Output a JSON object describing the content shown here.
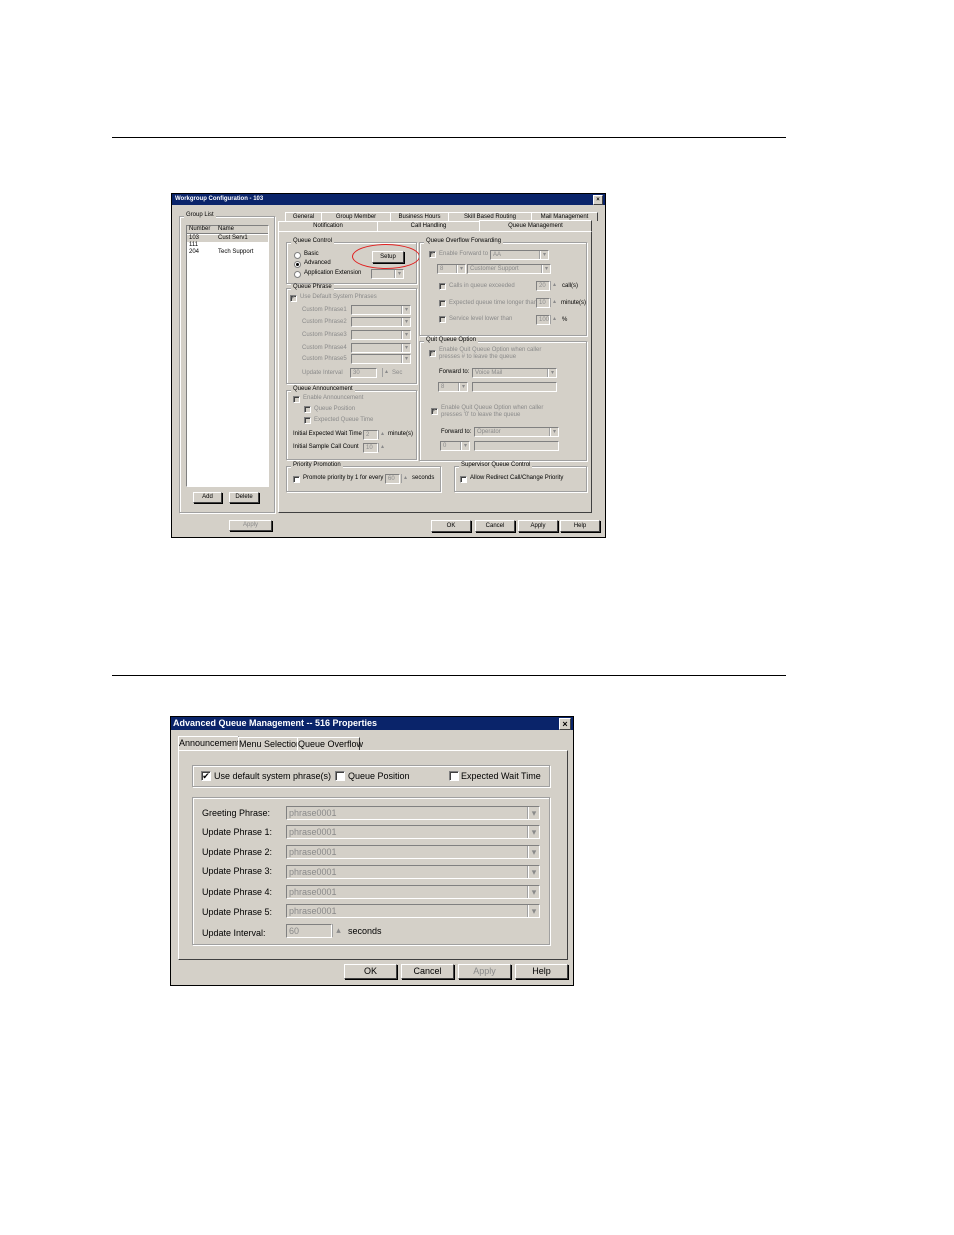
{
  "shot1": {
    "title": "Workgroup Configuration - 103",
    "close": "×",
    "group_list": {
      "label": "Group List",
      "col_number": "Number",
      "col_name": "Name",
      "rows": [
        {
          "number": "103",
          "name": "Cust Serv1"
        },
        {
          "number": "111",
          "name": ""
        },
        {
          "number": "204",
          "name": "Tech Support"
        }
      ],
      "add": "Add",
      "delete": "Delete",
      "apply": "Apply"
    },
    "tabs_row1": [
      "General",
      "Group Member",
      "Business Hours",
      "Skill Based Routing",
      "Mail Management"
    ],
    "tabs_row2": [
      "Notification",
      "Call Handling",
      "Queue Management"
    ],
    "queue_control": {
      "label": "Queue Control",
      "basic": "Basic",
      "advanced": "Advanced",
      "app_ext": "Application Extension",
      "setup": "Setup"
    },
    "queue_phrase": {
      "label": "Queue Phrase",
      "use_default": "Use Default System Phrases",
      "custom": [
        "Custom Phrase1",
        "Custom Phrase2",
        "Custom Phrase3",
        "Custom Phrase4",
        "Custom Phrase5"
      ],
      "update_interval": "Update Interval",
      "interval_value": "30",
      "unit": "Sec"
    },
    "queue_announcement": {
      "label": "Queue Announcement",
      "enable": "Enable Announcement",
      "queue_position": "Queue Position",
      "expected_time": "Expected Queue Time",
      "initial_wait": "Initial Expected Wait Time",
      "initial_wait_value": "2",
      "wait_unit": "minute(s)",
      "sample_count": "Initial Sample Call Count",
      "sample_value": "10"
    },
    "priority": {
      "label": "Priority Promotion",
      "promote": "Promote priority by 1 for every",
      "value": "60",
      "unit": "seconds"
    },
    "overflow": {
      "label": "Queue Overflow Forwarding",
      "enable_fwd": "Enable Forward to",
      "fwd_value": "AA",
      "num_value": "8",
      "target_value": "Customer Support",
      "calls_in_queue": "Calls in queue exceeded",
      "calls_value": "20",
      "calls_unit": "call(s)",
      "expected_wait": "Expected queue time longer than",
      "wait_value": "10",
      "wait_unit": "minute(s)",
      "service_level": "Service level lower than",
      "level_value": "100",
      "level_unit": "%"
    },
    "quit_queue": {
      "label": "Quit Queue Option",
      "enable1a": "Enable Quit Queue Option when caller",
      "enable1b": "presses # to leave the queue",
      "forward_to": "Forward to:",
      "fwd1_value": "Voice Mail",
      "num1_value": "8",
      "enable2a": "Enable Quit Queue Option when caller",
      "enable2b": "presses '0' to leave the queue",
      "fwd2_value": "Operator",
      "num2_value": "0"
    },
    "supervisor": {
      "label": "Supervisor Queue Control",
      "allow": "Allow Redirect Call/Change Priority"
    },
    "footer": {
      "ok": "OK",
      "cancel": "Cancel",
      "apply": "Apply",
      "help": "Help"
    }
  },
  "shot2": {
    "title": "Advanced Queue Management -- 516 Properties",
    "close": "×",
    "tabs": [
      "Announcement",
      "Menu Selection",
      "Queue Overflow"
    ],
    "use_default": "Use default system phrase(s)",
    "queue_position": "Queue Position",
    "expected_wait": "Expected Wait Time",
    "phrases": [
      {
        "label": "Greeting Phrase:",
        "value": "phrase0001"
      },
      {
        "label": "Update Phrase 1:",
        "value": "phrase0001"
      },
      {
        "label": "Update Phrase 2:",
        "value": "phrase0001"
      },
      {
        "label": "Update Phrase 3:",
        "value": "phrase0001"
      },
      {
        "label": "Update Phrase 4:",
        "value": "phrase0001"
      },
      {
        "label": "Update Phrase 5:",
        "value": "phrase0001"
      }
    ],
    "update_interval": "Update Interval:",
    "interval_value": "60",
    "seconds": "seconds",
    "footer": {
      "ok": "OK",
      "cancel": "Cancel",
      "apply": "Apply",
      "help": "Help"
    }
  },
  "icons": {
    "check": "✔",
    "arrow": "▾",
    "up": "▴"
  },
  "colors": {
    "titlebar": "#0a246a",
    "face": "#d4d0c8",
    "highlight_circle": "#e02020"
  }
}
